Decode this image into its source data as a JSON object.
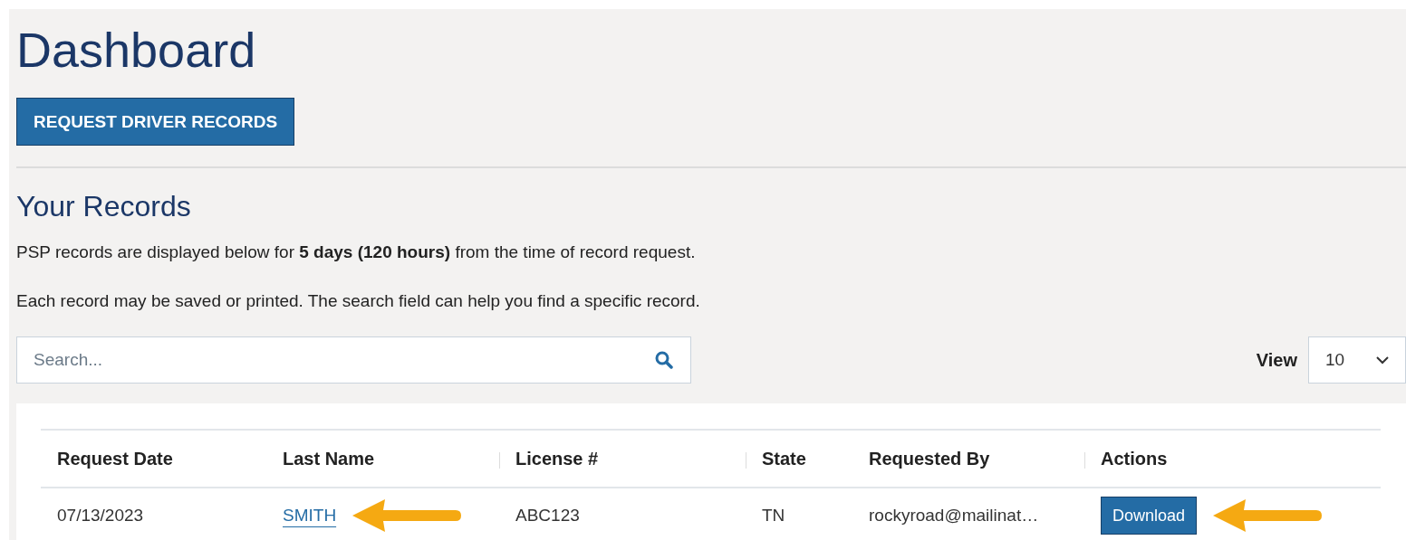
{
  "page_title": "Dashboard",
  "request_button": "REQUEST DRIVER RECORDS",
  "section_title": "Your Records",
  "notes": [
    "PSP records are displayed below for **5 days (120 hours)** from the time of record request.",
    "Each record may be saved or printed. The search field can help you find a specific record."
  ],
  "search": {
    "placeholder": "Search..."
  },
  "view": {
    "label": "View",
    "value": "10"
  },
  "table": {
    "columns": [
      "Request Date",
      "Last Name",
      "License #",
      "State",
      "Requested By",
      "Actions"
    ],
    "rows": [
      {
        "request_date": "07/13/2023",
        "last_name": "SMITH",
        "last_name_highlighted": true,
        "license": "ABC123",
        "state": "TN",
        "requested_by": "rockyroad@mailinat…",
        "action": "Download",
        "action_highlighted": true
      }
    ]
  }
}
